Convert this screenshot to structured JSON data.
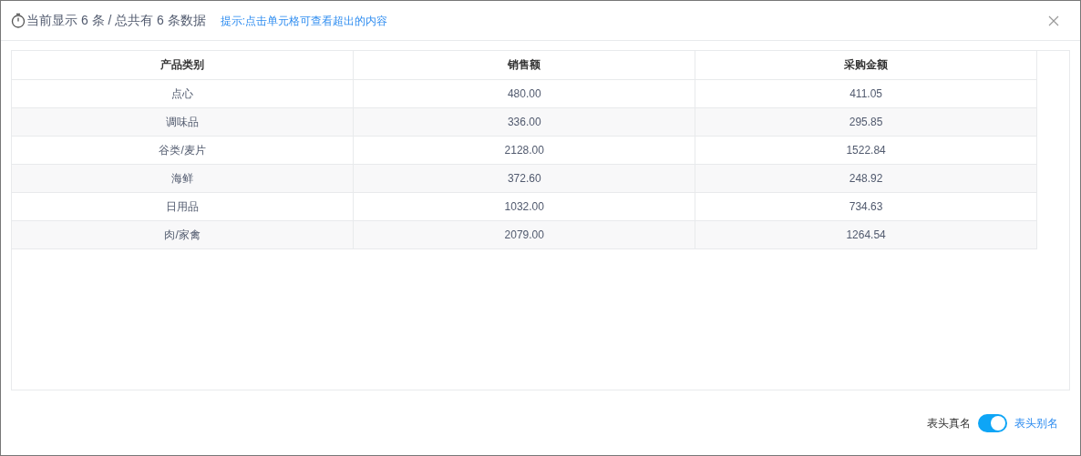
{
  "header": {
    "summary": "当前显示 6 条 / 总共有 6 条数据",
    "hint": "提示:点击单元格可查看超出的内容"
  },
  "table": {
    "columns": [
      "产品类别",
      "销售额",
      "采购金额"
    ],
    "rows": [
      [
        "点心",
        "480.00",
        "411.05"
      ],
      [
        "调味品",
        "336.00",
        "295.85"
      ],
      [
        "谷类/麦片",
        "2128.00",
        "1522.84"
      ],
      [
        "海鲜",
        "372.60",
        "248.92"
      ],
      [
        "日用品",
        "1032.00",
        "734.63"
      ],
      [
        "肉/家禽",
        "2079.00",
        "1264.54"
      ]
    ]
  },
  "footer": {
    "off_label": "表头真名",
    "on_label": "表头别名",
    "on": true
  }
}
